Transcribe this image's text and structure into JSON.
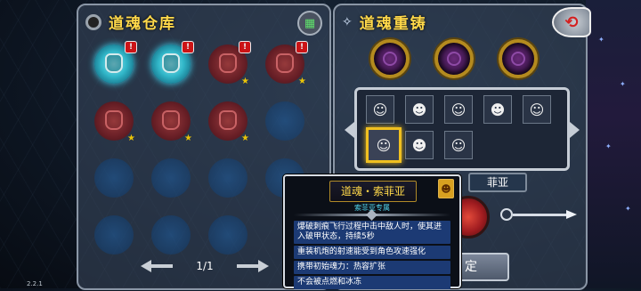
{
  "left_panel": {
    "title": "道魂仓库",
    "page": "1/1",
    "slots": [
      {
        "style": "cyan",
        "alert": "!",
        "star": false
      },
      {
        "style": "cyan",
        "alert": "!",
        "star": false
      },
      {
        "style": "red",
        "alert": "!",
        "star": true
      },
      {
        "style": "red",
        "alert": "!",
        "star": true
      },
      {
        "style": "red",
        "alert": "",
        "star": true
      },
      {
        "style": "red",
        "alert": "",
        "star": true
      },
      {
        "style": "red",
        "alert": "",
        "star": true
      },
      {
        "style": "empty",
        "alert": "",
        "star": false
      },
      {
        "style": "empty",
        "alert": "",
        "star": false
      },
      {
        "style": "empty",
        "alert": "",
        "star": false
      },
      {
        "style": "empty",
        "alert": "",
        "star": false
      },
      {
        "style": "empty",
        "alert": "",
        "star": false
      },
      {
        "style": "empty",
        "alert": "",
        "star": false
      },
      {
        "style": "empty",
        "alert": "",
        "star": false
      },
      {
        "style": "empty",
        "alert": "",
        "star": false
      }
    ]
  },
  "right_panel": {
    "title": "道魂重铸",
    "selected_name": "菲亚",
    "confirm_label": "定",
    "selected_index": 5
  },
  "tooltip": {
    "title": "道魂・索菲亚",
    "subtitle": "索菲亚专属",
    "badge_icon": "☻",
    "lines": [
      "爆破刺痕飞行过程中击中敌人时，使其进入破甲状态，持续5秒",
      "重装机炮的射速能受到角色攻速强化",
      "携带初始魂力：热容扩张",
      "不会被点燃和冰冻"
    ]
  },
  "version": "2.2.1"
}
